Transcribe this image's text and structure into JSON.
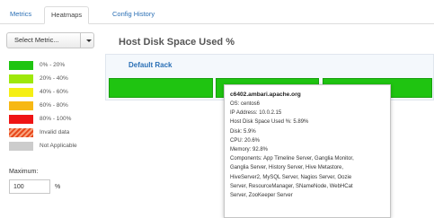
{
  "tabs": [
    {
      "label": "Metrics"
    },
    {
      "label": "Heatmaps"
    },
    {
      "label": "Config History"
    }
  ],
  "select_metric": {
    "label": "Select Metric..."
  },
  "legend": [
    {
      "label": "0% - 20%",
      "color": "#1fc411"
    },
    {
      "label": "20% - 40%",
      "color": "#9ee80a"
    },
    {
      "label": "40% - 60%",
      "color": "#f5ef14"
    },
    {
      "label": "60% - 80%",
      "color": "#f7b814"
    },
    {
      "label": "80% - 100%",
      "color": "#ef1414"
    },
    {
      "label": "Invalid data",
      "color": "#e8471b"
    },
    {
      "label": "Not Applicable",
      "color": "#cccccc"
    }
  ],
  "maximum": {
    "label": "Maximum:",
    "value": "100",
    "unit": "%"
  },
  "main": {
    "title": "Host Disk Space Used %",
    "rack_title": "Default Rack",
    "host_color": "#1fc411"
  },
  "tooltip": {
    "host_name": "c6402.ambari.apache.org",
    "lines": [
      "OS: centos6",
      "IP Address: 10.0.2.15",
      "Host Disk Space Used %: 5.89%",
      "Disk: 5.9%",
      "CPU: 20.6%",
      "Memory: 92.8%",
      "Components: App Timeline Server, Ganglia Monitor,",
      "Ganglia Server, History Server, Hive Metastore,",
      "HiveServer2, MySQL Server, Nagios Server, Oozie",
      "Server, ResourceManager, SNameNode, WebHCat",
      "Server, ZooKeeper Server"
    ]
  }
}
